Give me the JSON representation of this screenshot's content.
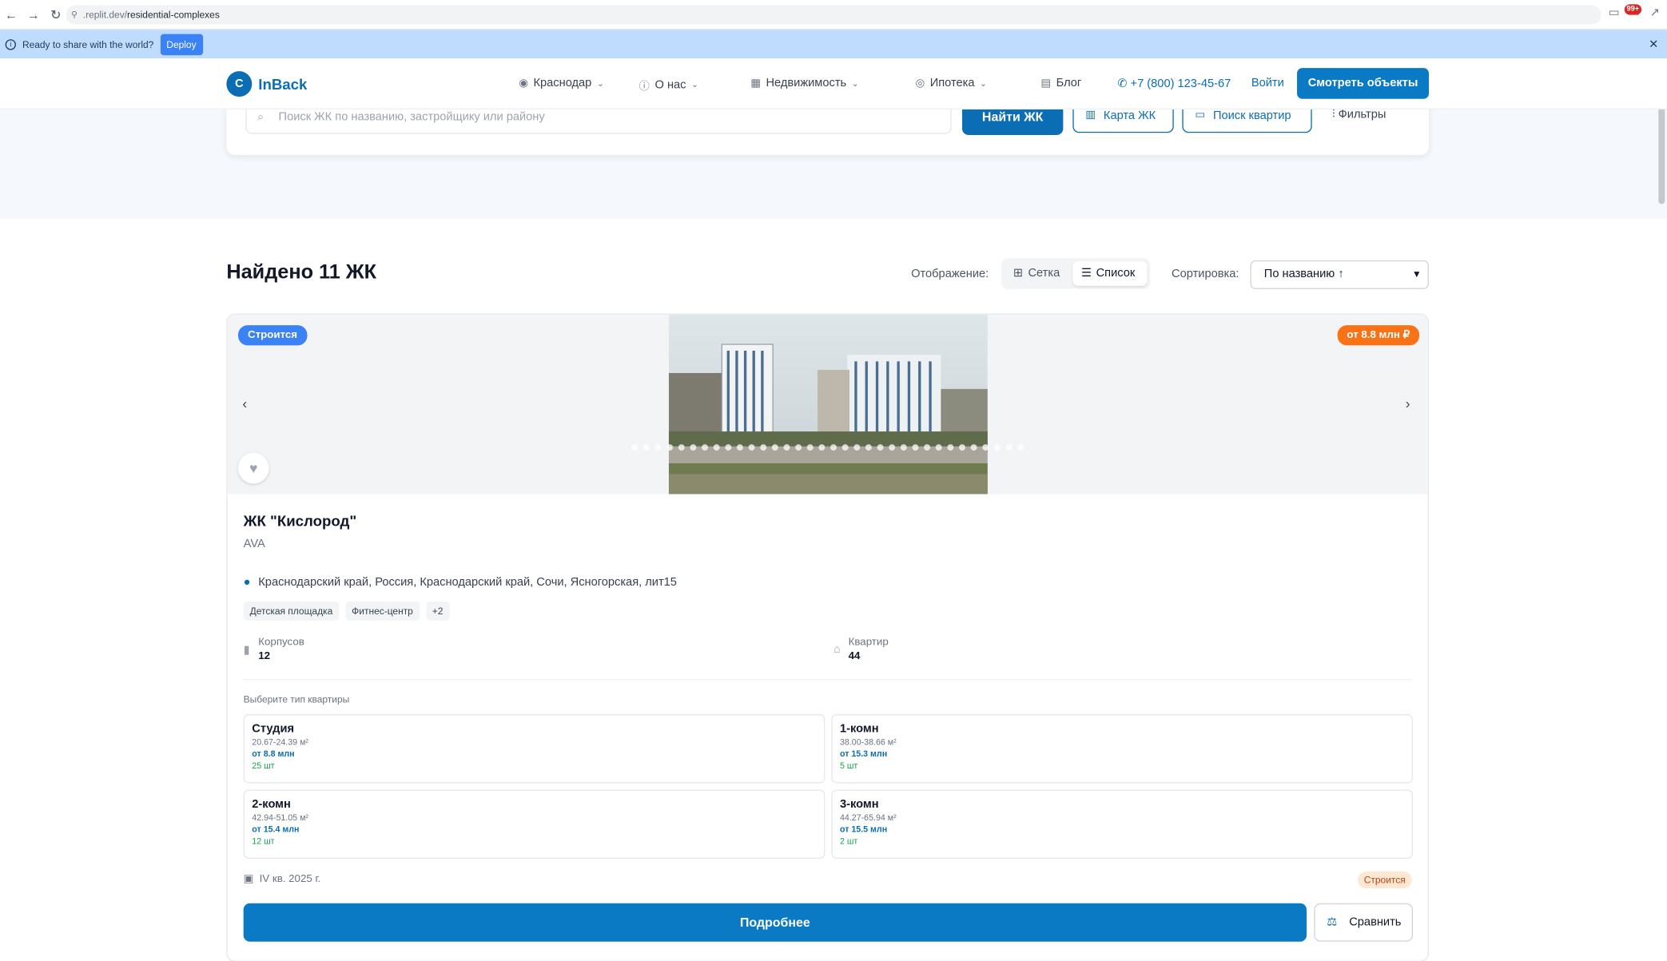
{
  "browser": {
    "url_prefix": ".replit.dev/",
    "url_path": "residential-complexes",
    "notif_badge": "99+"
  },
  "deploy_bar": {
    "text": "Ready to share with the world?",
    "button": "Deploy"
  },
  "header": {
    "brand_letter": "C",
    "brand": "InBack",
    "nav": [
      {
        "label": "Краснодар",
        "icon": "location-pin-icon"
      },
      {
        "label": "О нас",
        "icon": "info-icon"
      },
      {
        "label": "Недвижимость",
        "icon": "building-icon"
      },
      {
        "label": "Ипотека",
        "icon": "coin-icon"
      },
      {
        "label": "Блог",
        "icon": "newspaper-icon"
      }
    ],
    "phone": "+7 (800) 123-45-67",
    "login": "Войти",
    "cta": "Смотреть объекты"
  },
  "search": {
    "placeholder": "Поиск ЖК по названию, застройщику или району",
    "find_button": "Найти ЖК",
    "map_button": "Карта ЖК",
    "apartments_button": "Поиск квартир",
    "filters": "Фильтры"
  },
  "results": {
    "title": "Найдено 11 ЖК",
    "display_label": "Отображение:",
    "view_grid": "Сетка",
    "view_list": "Список",
    "active_view": "Список",
    "sort_label": "Сортировка:",
    "sort_value": "По названию ↑"
  },
  "card": {
    "status": "Строится",
    "price_badge": "от 8.8 млн ₽",
    "title": "ЖК \"Кислород\"",
    "developer": "AVA",
    "address": "Краснодарский край, Россия, Краснодарский край, Сочи, Ясногорская, лит15",
    "tags": [
      "Детская площадка",
      "Фитнес-центр",
      "+2"
    ],
    "buildings_label": "Корпусов",
    "buildings_value": "12",
    "apartments_label": "Квартир",
    "apartments_value": "44",
    "pick_label": "Выберите тип квартиры",
    "apartment_types": [
      {
        "name": "Студия",
        "area": "20.67-24.39 м²",
        "price": "от 8.8 млн",
        "count": "25 шт"
      },
      {
        "name": "1-комн",
        "area": "38.00-38.66 м²",
        "price": "от 15.3 млн",
        "count": "5 шт"
      },
      {
        "name": "2-комн",
        "area": "42.94-51.05 м²",
        "price": "от 15.4 млн",
        "count": "12 шт"
      },
      {
        "name": "3-комн",
        "area": "44.27-65.94 м²",
        "price": "от 15.5 млн",
        "count": "2 шт"
      }
    ],
    "completion": "IV кв. 2025 г.",
    "status_small": "Строится",
    "details_button": "Подробнее",
    "compare_button": "Сравнить"
  },
  "colors": {
    "primary": "#0b7ac4",
    "status_blue": "#3b82f6",
    "price_orange": "#f97316"
  }
}
